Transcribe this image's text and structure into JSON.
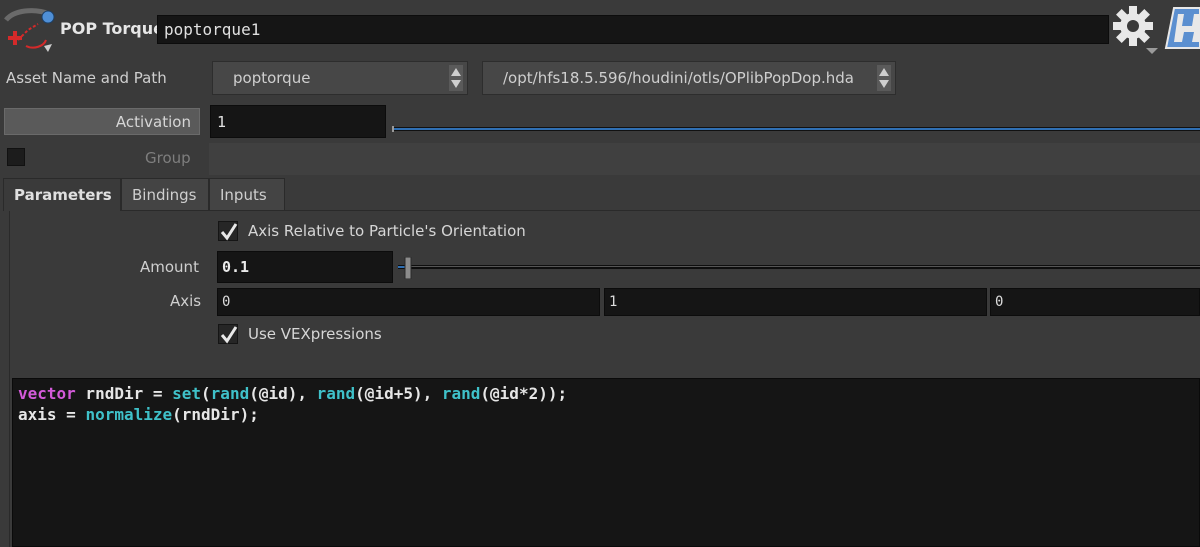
{
  "header": {
    "node_type": "POP Torque",
    "node_name": "poptorque1"
  },
  "asset": {
    "label": "Asset Name and Path",
    "name": "poptorque",
    "path": "/opt/hfs18.5.596/houdini/otls/OPlibPopDop.hda"
  },
  "activation": {
    "label": "Activation",
    "value": "1"
  },
  "group": {
    "label": "Group",
    "value": ""
  },
  "tabs": [
    {
      "label": "Parameters",
      "active": true
    },
    {
      "label": "Bindings",
      "active": false
    },
    {
      "label": "Inputs",
      "active": false
    }
  ],
  "parameters": {
    "axis_relative": {
      "label": "Axis Relative to Particle's Orientation",
      "checked": true
    },
    "amount": {
      "label": "Amount",
      "value": "0.1"
    },
    "axis": {
      "label": "Axis",
      "x": "0",
      "y": "1",
      "z": "0"
    },
    "use_vex": {
      "label": "Use VEXpressions",
      "checked": true
    }
  },
  "code": {
    "line1": {
      "kw": "vector",
      "t1": " rndDir = ",
      "f1": "set",
      "t2": "(",
      "f2": "rand",
      "t3": "(@id), ",
      "f3": "rand",
      "t4": "(@id+5), ",
      "f4": "rand",
      "t5": "(@id*2));"
    },
    "line2": {
      "t1": "axis = ",
      "f1": "normalize",
      "t2": "(rndDir);"
    }
  },
  "colors": {
    "keyword": "#d35ad9",
    "function": "#3fc1c9",
    "background": "#3a3a3a",
    "field": "#151515"
  },
  "icons": {
    "node": "pop-torque-icon",
    "gear": "gear-icon",
    "help": "help-icon"
  }
}
